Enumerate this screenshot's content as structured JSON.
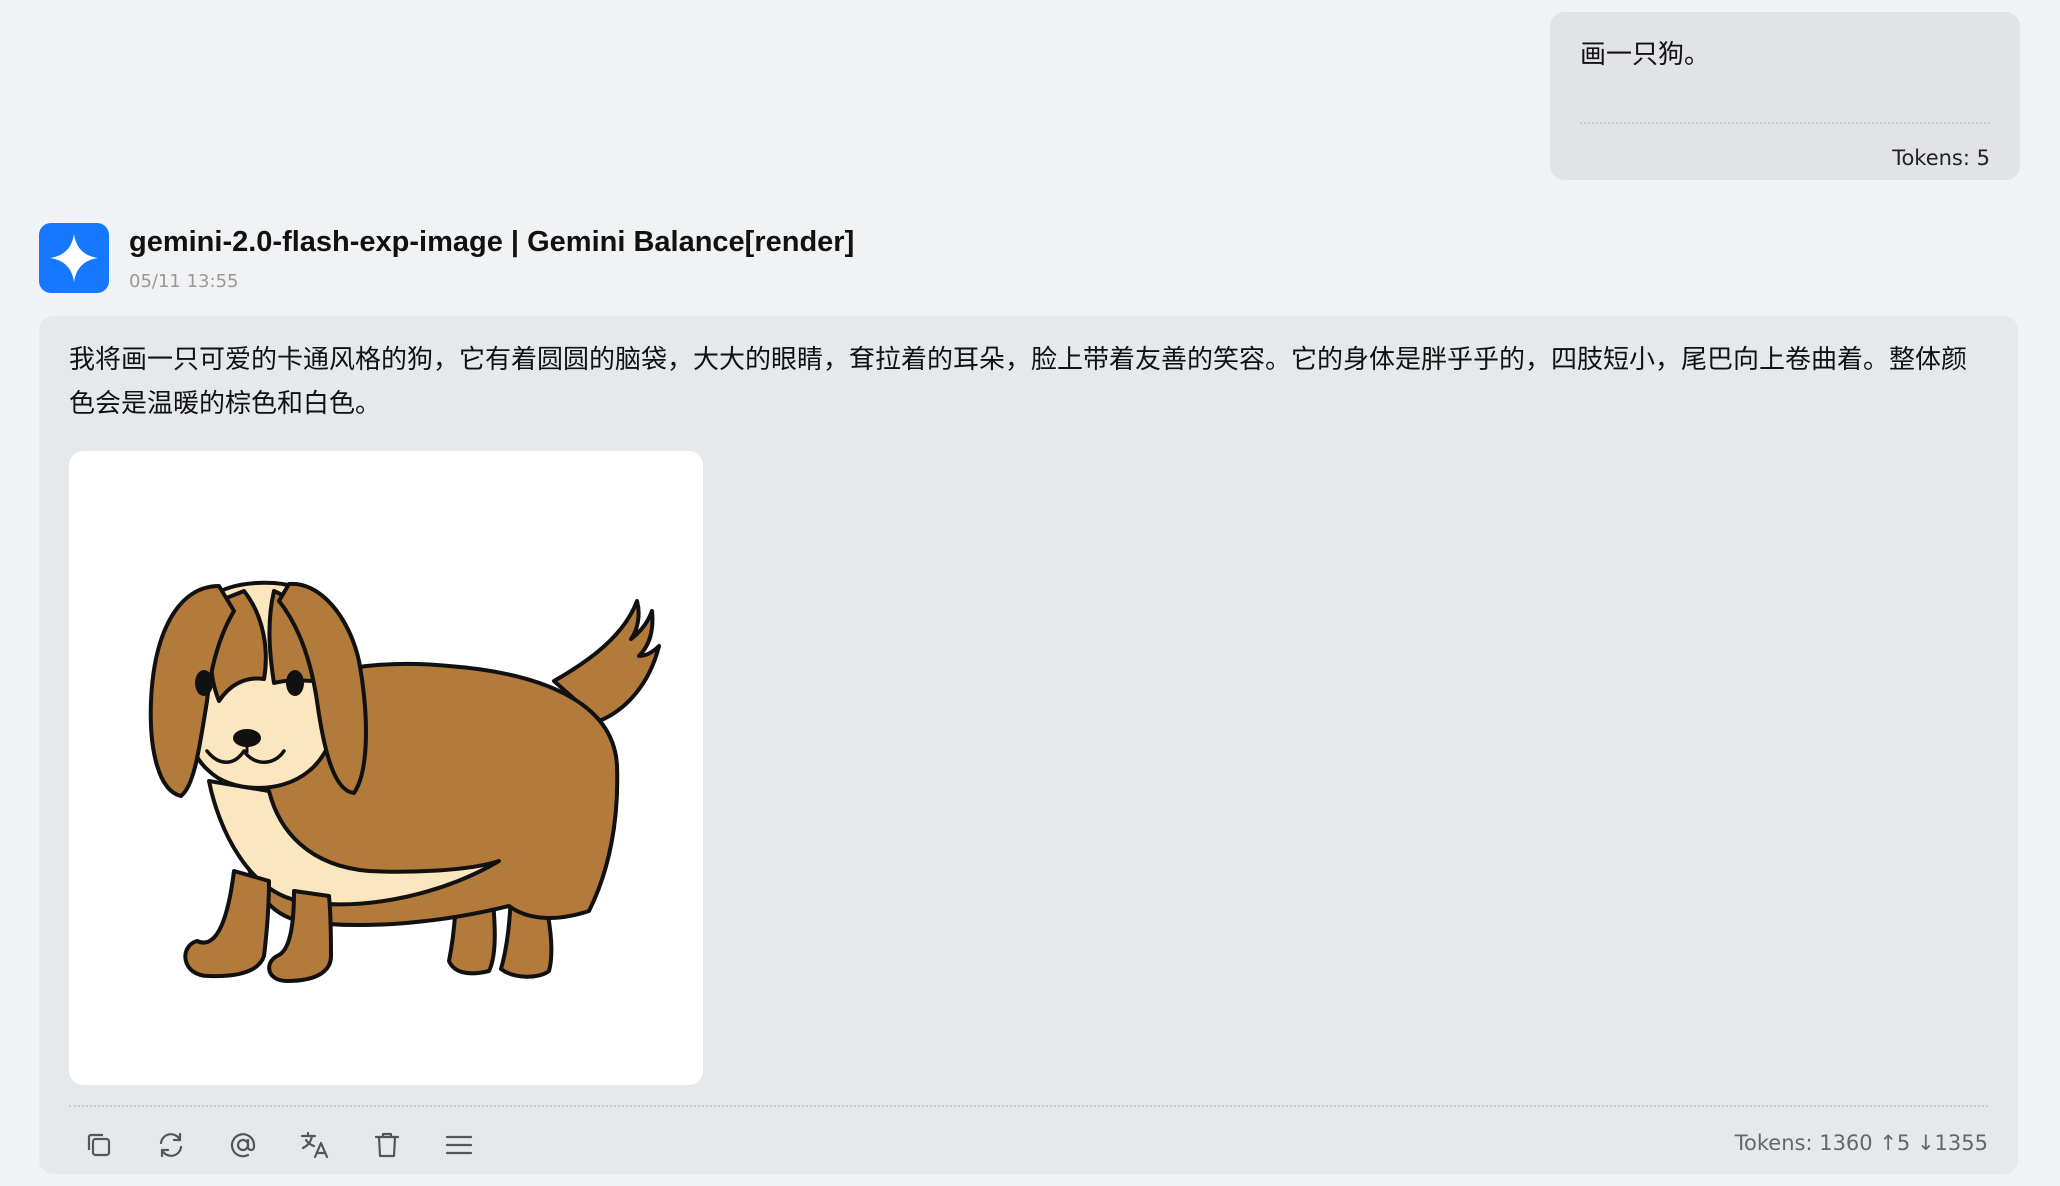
{
  "user_message": {
    "text": "画一只狗。",
    "tokens": "Tokens: 5"
  },
  "assistant_message": {
    "avatar_icon": "sparkle-icon",
    "model_name": "gemini-2.0-flash-exp-image | Gemini Balance[render]",
    "timestamp": "05/11 13:55",
    "text": "我将画一只可爱的卡通风格的狗，它有着圆圆的脑袋，大大的眼睛，耷拉着的耳朵，脸上带着友善的笑容。它的身体是胖乎乎的，四肢短小，尾巴向上卷曲着。整体颜色会是温暖的棕色和白色。",
    "image_icon": "cartoon-dog-image",
    "tokens": "Tokens: 1360 ↑5 ↓1355",
    "toolbar": [
      {
        "name": "copy-icon"
      },
      {
        "name": "regenerate-icon"
      },
      {
        "name": "mention-icon"
      },
      {
        "name": "translate-icon"
      },
      {
        "name": "delete-icon"
      },
      {
        "name": "menu-icon"
      }
    ]
  },
  "colors": {
    "page_bg": "#f1f2f4",
    "user_bubble": "#e1e3e6",
    "assistant_bubble": "#e6e9eb",
    "avatar_blue": "#1677ff",
    "dog_brown": "#b27a3b",
    "dog_cream": "#fce6bf"
  }
}
